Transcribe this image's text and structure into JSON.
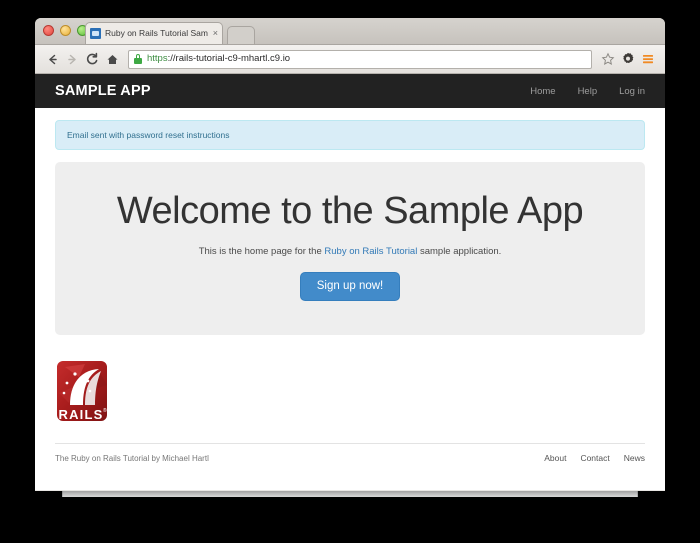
{
  "browser": {
    "window_controls": [
      "close",
      "minimize",
      "zoom"
    ],
    "tab": {
      "title": "Ruby on Rails Tutorial Sam",
      "close_label": "×",
      "favicon": "rails-favicon"
    },
    "toolbar": {
      "back_icon": "back-arrow-icon",
      "forward_icon": "forward-arrow-icon",
      "reload_icon": "reload-icon",
      "home_icon": "home-icon",
      "lock_icon": "lock-icon",
      "url_scheme": "https",
      "url_rest": "://rails-tutorial-c9-mhartl.c9.io",
      "url_full": "https://rails-tutorial-c9-mhartl.c9.io",
      "bookmark_icon": "star-icon",
      "settings_icon": "gear-icon",
      "menu_icon": "hamburger-menu-icon"
    }
  },
  "page": {
    "navbar": {
      "brand": "SAMPLE APP",
      "links": [
        {
          "label": "Home"
        },
        {
          "label": "Help"
        },
        {
          "label": "Log in"
        }
      ]
    },
    "alert": {
      "message": "Email sent with password reset instructions"
    },
    "jumbotron": {
      "heading": "Welcome to the Sample App",
      "lead_before": "This is the home page for the ",
      "lead_link": "Ruby on Rails Tutorial",
      "lead_after": " sample application.",
      "cta_label": "Sign up now!"
    },
    "logo": {
      "name": "rails-logo",
      "wordmark": "RAILS",
      "trademark": "®"
    },
    "footer": {
      "credit_link": "The Ruby on Rails Tutorial",
      "credit_rest": " by Michael Hartl",
      "links": [
        {
          "label": "About"
        },
        {
          "label": "Contact"
        },
        {
          "label": "News"
        }
      ]
    }
  },
  "colors": {
    "navbar_bg": "#222222",
    "alert_bg": "#d9edf7",
    "alert_border": "#bce8f1",
    "alert_text": "#31708f",
    "jumbotron_bg": "#eeeeee",
    "primary_button": "#428bca",
    "link_blue": "#337ab7",
    "rails_red": "#a61b1b"
  }
}
